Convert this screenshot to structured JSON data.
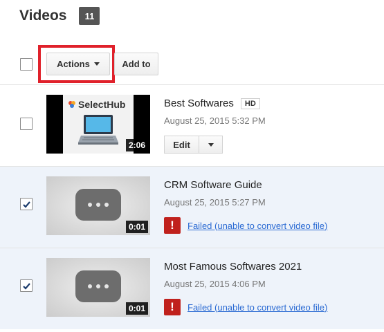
{
  "header": {
    "title": "Videos",
    "count": "11"
  },
  "toolbar": {
    "actions_label": "Actions",
    "add_to_label": "Add to"
  },
  "videos": [
    {
      "title": "Best Softwares",
      "badge": "HD",
      "date": "August 25, 2015 5:32 PM",
      "duration": "2:06",
      "thumbnail_logo": "SelectHub",
      "edit_label": "Edit",
      "checked": false
    },
    {
      "title": "CRM Software Guide",
      "date": "August 25, 2015 5:27 PM",
      "duration": "0:01",
      "error_text": "Failed (unable to convert video file)",
      "checked": true
    },
    {
      "title": "Most Famous Softwares 2021",
      "date": "August 25, 2015 4:06 PM",
      "duration": "0:01",
      "error_text": "Failed (unable to convert video file)",
      "checked": true
    }
  ],
  "colors": {
    "highlight": "#e0212b",
    "selected_row": "#eef3fa",
    "error": "#c0211d",
    "link": "#2a6ad3",
    "badge": "#555555"
  },
  "icons": {
    "error": "!",
    "checkmark": "checkmark-icon",
    "caret": "caret-down-icon",
    "logo_mark": "selecthub-logo-icon",
    "thumb": "laptop-icon"
  }
}
